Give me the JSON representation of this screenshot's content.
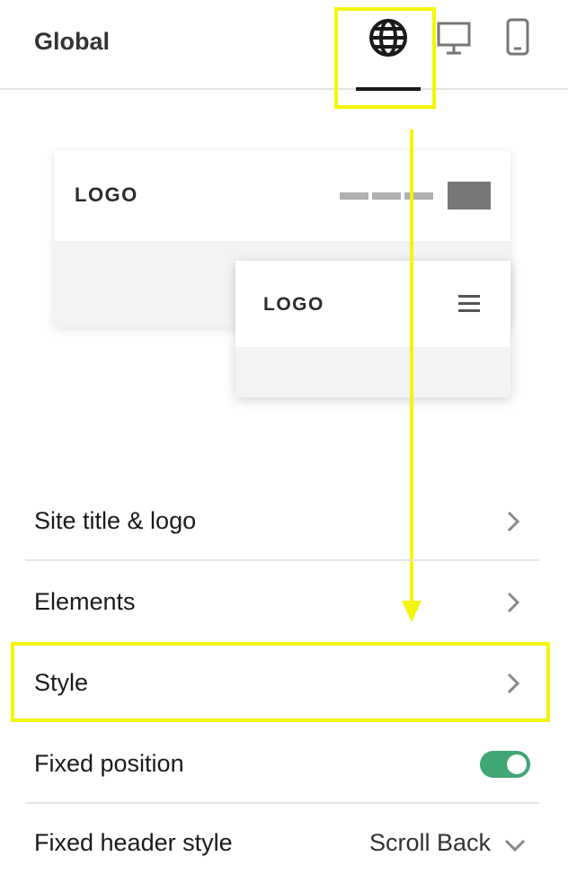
{
  "header": {
    "title": "Global",
    "icons": [
      "globe-icon",
      "desktop-icon",
      "mobile-icon"
    ],
    "active_tab": "globe-icon"
  },
  "preview": {
    "desktop_logo": "LOGO",
    "mobile_logo": "LOGO"
  },
  "menu": {
    "items": [
      {
        "label": "Site title & logo"
      },
      {
        "label": "Elements"
      },
      {
        "label": "Style"
      }
    ],
    "fixed_position": {
      "label": "Fixed position",
      "enabled": true
    },
    "fixed_header_style": {
      "label": "Fixed header style",
      "value": "Scroll Back"
    }
  },
  "colors": {
    "highlight": "#f5f50a",
    "toggle_on": "#3fa674"
  }
}
